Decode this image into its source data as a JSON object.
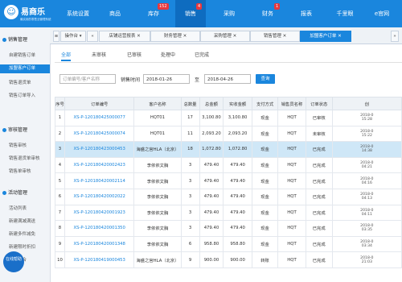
{
  "logo": {
    "name": "易商乐",
    "sub": "最实用的零售业管理系统"
  },
  "nav": [
    {
      "label": "系统设置"
    },
    {
      "label": "商品"
    },
    {
      "label": "库存",
      "badge": "152"
    },
    {
      "label": "销售",
      "badge": "4"
    },
    {
      "label": "采购"
    },
    {
      "label": "财务",
      "badge": "1"
    },
    {
      "label": "报表"
    },
    {
      "label": "千里眼"
    },
    {
      "label": "e官网"
    }
  ],
  "sidebar": {
    "sections": [
      {
        "title": "销售管理",
        "items": [
          "自建销售订单",
          "加盟客户订单",
          "销售退货单",
          "销售订单导入"
        ]
      },
      {
        "title": "审核管理",
        "items": [
          "销售审核",
          "销售退货单审核",
          "销售单审核"
        ]
      },
      {
        "title": "活动管理",
        "items": [
          "活动列表",
          "新建满减满送",
          "新建多件减免",
          "新建限时折扣",
          "新建组合"
        ]
      }
    ],
    "help_label": "在线帮助"
  },
  "tabstrip": {
    "ops_label": "操作台",
    "tabs": [
      "店铺运营报表",
      "财务管理",
      "采购管理",
      "销售管理",
      "加盟客户订单"
    ]
  },
  "subtabs": [
    "全部",
    "未审核",
    "已审核",
    "处理中",
    "已完成"
  ],
  "filter": {
    "search_placeholder": "订单编号/客户名称",
    "time_label": "销售时间",
    "date_from": "2018-01-26",
    "to_label": "至",
    "date_to": "2018-04-26",
    "query_label": "查询"
  },
  "table": {
    "headers": [
      "序号",
      "订单编号",
      "客户名称",
      "总数量",
      "总金额",
      "实收金额",
      "支付方式",
      "销售员名称",
      "订单状态",
      "创"
    ],
    "rows": [
      {
        "idx": "1",
        "order": "XS-P-120180425000077",
        "customer": "HQT01",
        "qty": "17",
        "total": "3,100.80",
        "paid": "3,100.80",
        "pay": "现金",
        "seller": "HQT",
        "status": "已审核",
        "date1": "2018-0",
        "date2": "15:28"
      },
      {
        "idx": "2",
        "order": "XS-P-120180425000074",
        "customer": "HQT01",
        "qty": "11",
        "total": "2,093.20",
        "paid": "2,093.20",
        "pay": "现金",
        "seller": "HQT",
        "status": "未审核",
        "date1": "2018-0",
        "date2": "15:22"
      },
      {
        "idx": "3",
        "order": "XS-P-120180423000453",
        "customer": "海盛之宫HLA（北京）",
        "qty": "18",
        "total": "1,072.80",
        "paid": "1,072.80",
        "pay": "现金",
        "seller": "HQT",
        "status": "已完成",
        "date1": "2018-0",
        "date2": "14:38"
      },
      {
        "idx": "4",
        "order": "XS-P-120180420002423",
        "customer": "李依依文胸",
        "qty": "3",
        "total": "479.40",
        "paid": "479.40",
        "pay": "现金",
        "seller": "HQT",
        "status": "已完成",
        "date1": "2018-0",
        "date2": "04:21"
      },
      {
        "idx": "5",
        "order": "XS-P-120180420002114",
        "customer": "李依依文胸",
        "qty": "3",
        "total": "479.40",
        "paid": "479.40",
        "pay": "现金",
        "seller": "HQT",
        "status": "已完成",
        "date1": "2018-0",
        "date2": "04:16"
      },
      {
        "idx": "6",
        "order": "XS-P-120180420002022",
        "customer": "李依依文胸",
        "qty": "3",
        "total": "479.40",
        "paid": "479.40",
        "pay": "现金",
        "seller": "HQT",
        "status": "已完成",
        "date1": "2018-0",
        "date2": "04:13"
      },
      {
        "idx": "7",
        "order": "XS-P-120180420001923",
        "customer": "李依依文胸",
        "qty": "3",
        "total": "479.40",
        "paid": "479.40",
        "pay": "现金",
        "seller": "HQT",
        "status": "已完成",
        "date1": "2018-0",
        "date2": "04:11"
      },
      {
        "idx": "8",
        "order": "XS-P-120180420001350",
        "customer": "李依依文胸",
        "qty": "3",
        "total": "479.40",
        "paid": "479.40",
        "pay": "现金",
        "seller": "HQT",
        "status": "已完成",
        "date1": "2018-0",
        "date2": "03:35"
      },
      {
        "idx": "9",
        "order": "XS-P-120180420001348",
        "customer": "李依依文胸",
        "qty": "6",
        "total": "958.80",
        "paid": "958.80",
        "pay": "现金",
        "seller": "HQT",
        "status": "已完成",
        "date1": "2018-0",
        "date2": "03:34"
      },
      {
        "idx": "10",
        "order": "XS-P-120180419000453",
        "customer": "海盛之宫HLA（北京）",
        "qty": "9",
        "total": "900.00",
        "paid": "900.00",
        "pay": "转账",
        "seller": "HQT",
        "status": "已完成",
        "date1": "2018-0",
        "date2": "21:03"
      }
    ]
  },
  "colors": {
    "primary": "#1a86dd",
    "selected_row": "#cfe7f7",
    "badge": "#e8383d"
  }
}
